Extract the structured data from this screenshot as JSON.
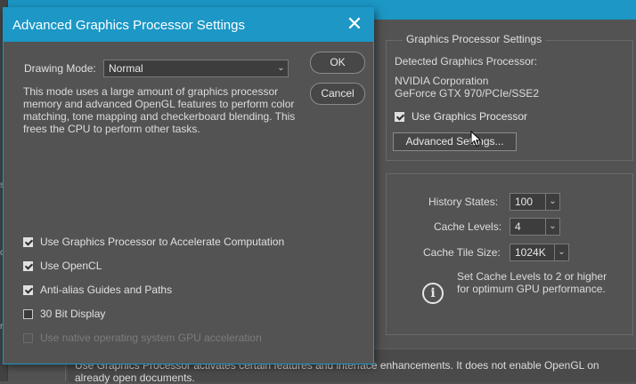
{
  "preferences": {
    "gps_group": {
      "title": "Graphics Processor Settings",
      "detected_label": "Detected Graphics Processor:",
      "gpu_vendor": "NVIDIA Corporation",
      "gpu_model": "GeForce GTX 970/PCIe/SSE2",
      "use_gpu": {
        "label": "Use Graphics Processor",
        "checked": true
      },
      "advanced_button": "Advanced Settings..."
    },
    "cache": {
      "history_label": "History States:",
      "history_value": "100",
      "levels_label": "Cache Levels:",
      "levels_value": "4",
      "tile_label": "Cache Tile Size:",
      "tile_value": "1024K",
      "info_line1": "Set Cache Levels to 2 or higher",
      "info_line2": "for optimum GPU performance.",
      "info_glyph": "i"
    },
    "bottom_note_line1": "Use Graphics Processor activates certain features and interface enhancements. It does not enable OpenGL on",
    "bottom_note_line2": "already open documents.",
    "left_strip_chars": [
      "s",
      "o",
      "r"
    ]
  },
  "dialog": {
    "title": "Advanced Graphics Processor Settings",
    "close_glyph": "✕",
    "drawing_mode_label": "Drawing Mode:",
    "drawing_mode_value": "Normal",
    "dropdown_arrow": "⌄",
    "ok_label": "OK",
    "cancel_label": "Cancel",
    "description": "This mode uses a large amount of graphics processor memory and advanced OpenGL features to perform color matching, tone mapping and checkerboard blending.  This frees the CPU to perform other tasks.",
    "options": [
      {
        "label": "Use Graphics Processor to Accelerate Computation",
        "checked": true,
        "enabled": true
      },
      {
        "label": "Use OpenCL",
        "checked": true,
        "enabled": true
      },
      {
        "label": "Anti-alias Guides and Paths",
        "checked": true,
        "enabled": true
      },
      {
        "label": "30 Bit Display",
        "checked": false,
        "enabled": true
      },
      {
        "label": "Use native operating system GPU acceleration",
        "checked": false,
        "enabled": false
      }
    ]
  },
  "colors": {
    "accent": "#1c97c6",
    "panel": "#535353",
    "text": "#dcdcdc"
  }
}
